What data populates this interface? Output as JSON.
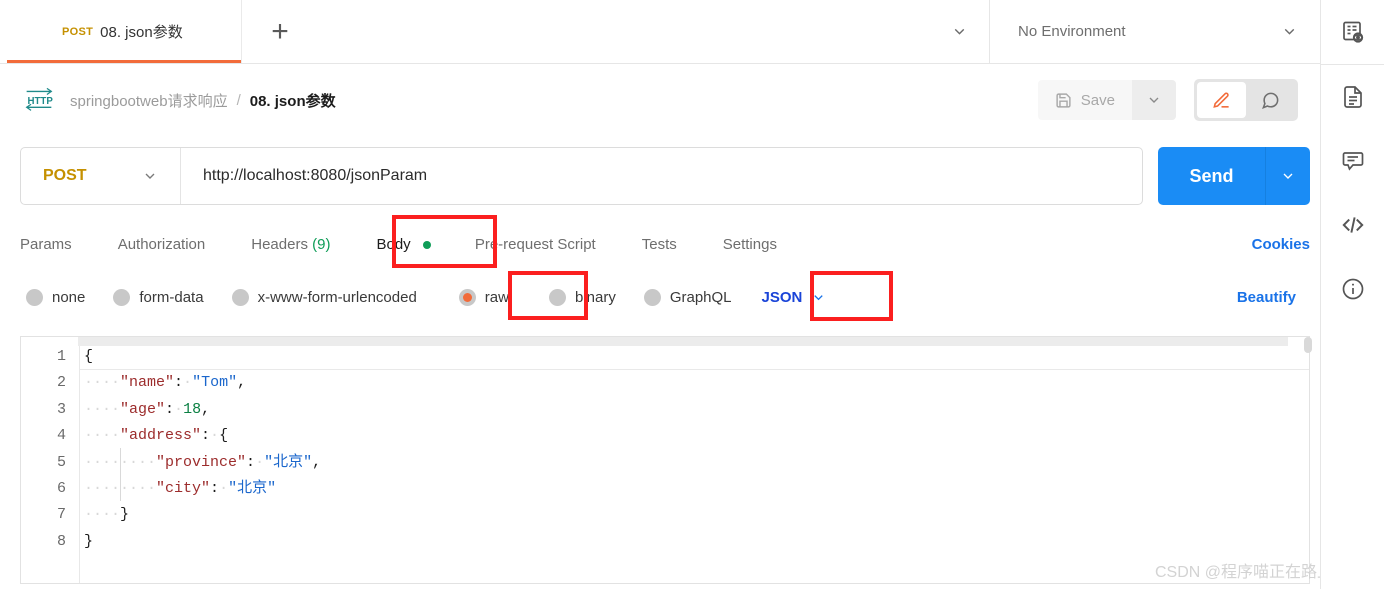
{
  "window": {
    "tab": {
      "method": "POST",
      "title": "08. json参数",
      "new_tab_icon": "plus-icon"
    },
    "tabs_chevron_icon": "chevron-down-icon",
    "environment": {
      "selected": "No Environment",
      "chevron_icon": "chevron-down-icon"
    },
    "env_quick_look_icon": "env-quick-look-icon"
  },
  "breadcrumb": {
    "protocol_icon": "http-icon",
    "parent": "springbootweb请求响应",
    "separator": "/",
    "current": "08. json参数"
  },
  "actions": {
    "save_label": "Save",
    "save_icon": "floppy-disk-icon",
    "save_caret_icon": "chevron-down-icon",
    "edit_icon": "pencil-icon",
    "comment_icon": "comment-icon"
  },
  "request": {
    "method": "POST",
    "method_caret_icon": "chevron-down-icon",
    "url": "http://localhost:8080/jsonParam",
    "send_label": "Send",
    "send_caret_icon": "chevron-down-icon",
    "comment_icon": "comment-icon"
  },
  "request_tabs": [
    {
      "label": "Params",
      "active": false
    },
    {
      "label": "Authorization",
      "active": false
    },
    {
      "label": "Headers",
      "count": "(9)",
      "active": false
    },
    {
      "label": "Body",
      "active": true,
      "dot": true
    },
    {
      "label": "Pre-request Script",
      "active": false
    },
    {
      "label": "Tests",
      "active": false
    },
    {
      "label": "Settings",
      "active": false
    }
  ],
  "cookies_label": "Cookies",
  "body_types": [
    {
      "label": "none",
      "selected": false
    },
    {
      "label": "form-data",
      "selected": false
    },
    {
      "label": "x-www-form-urlencoded",
      "selected": false
    },
    {
      "label": "raw",
      "selected": true
    },
    {
      "label": "binary",
      "selected": false
    },
    {
      "label": "GraphQL",
      "selected": false
    }
  ],
  "raw_format": {
    "label": "JSON",
    "caret_icon": "chevron-down-icon"
  },
  "beautify_label": "Beautify",
  "editor": {
    "line_numbers": [
      "1",
      "2",
      "3",
      "4",
      "5",
      "6",
      "7",
      "8"
    ],
    "raw_body": "{\n    \"name\": \"Tom\",\n    \"age\": 18,\n    \"address\": {\n        \"province\": \"北京\",\n        \"city\": \"北京\"\n    }\n}",
    "json_value": {
      "name": "Tom",
      "age": 18,
      "address": {
        "province": "北京",
        "city": "北京"
      }
    }
  },
  "right_rail": [
    {
      "icon": "env-quick-look-icon"
    },
    {
      "icon": "documentation-icon"
    },
    {
      "icon": "comment-icon"
    },
    {
      "icon": "code-snippet-icon"
    },
    {
      "icon": "info-icon"
    }
  ],
  "annotations": [
    {
      "target": "body-tab"
    },
    {
      "target": "raw-radio"
    },
    {
      "target": "json-format-select"
    }
  ],
  "watermark": "CSDN @程序喵正在路上",
  "colors": {
    "accent_orange": "#f26b3a",
    "send_blue": "#1a8cf5",
    "link_blue": "#1a73e8",
    "method_amber": "#c59000",
    "green": "#0f9d58",
    "annotation_red": "#fb1f1f"
  }
}
